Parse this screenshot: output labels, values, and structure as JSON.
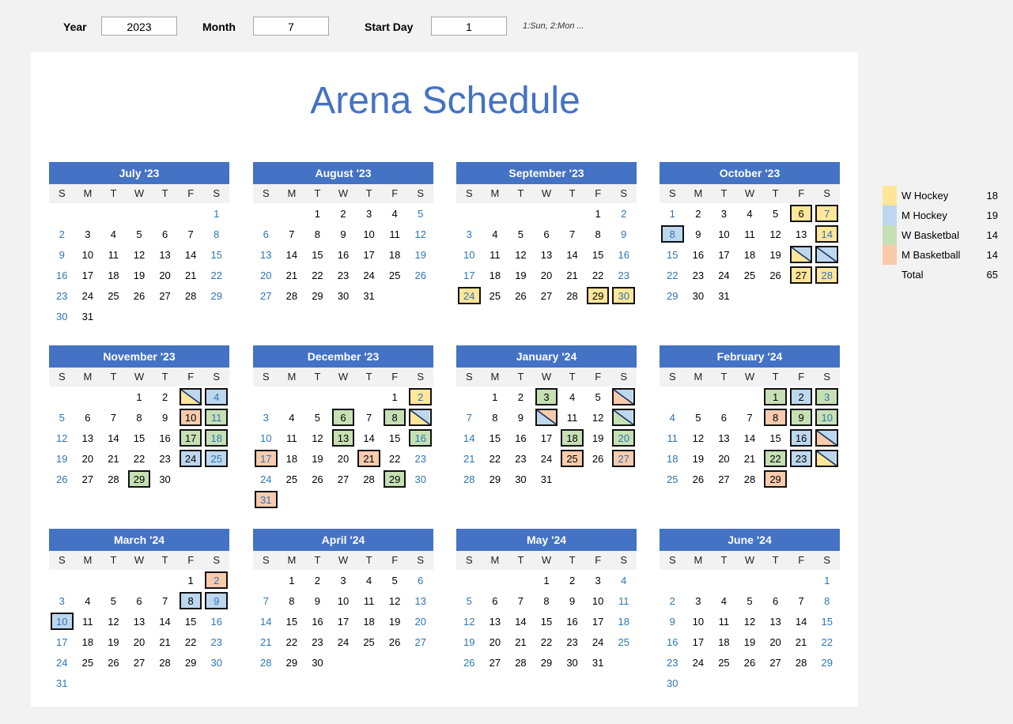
{
  "controls": {
    "year_label": "Year",
    "year_value": "2023",
    "month_label": "Month",
    "month_value": "7",
    "start_label": "Start Day",
    "start_value": "1",
    "hint": "1:Sun, 2:Mon ..."
  },
  "title": "Arena Schedule",
  "dow": [
    "S",
    "M",
    "T",
    "W",
    "T",
    "F",
    "S"
  ],
  "colors": {
    "wh": "#ffe699",
    "mh": "#bdd7ee",
    "wb": "#c6e0b4",
    "mb": "#f8cbad",
    "header": "#4472c4",
    "weekend": "#2e75b6"
  },
  "legend": [
    {
      "name": "W Hockey",
      "value": "18",
      "color": "wh"
    },
    {
      "name": "M Hockey",
      "value": "19",
      "color": "mh"
    },
    {
      "name": "W Basketbal",
      "value": "14",
      "color": "wb"
    },
    {
      "name": "M Basketball",
      "value": "14",
      "color": "mb"
    },
    {
      "name": "Total",
      "value": "65",
      "color": ""
    }
  ],
  "months": [
    {
      "name": "July '23",
      "start": 6,
      "days": 31,
      "events": {}
    },
    {
      "name": "August '23",
      "start": 2,
      "days": 31,
      "events": {}
    },
    {
      "name": "September '23",
      "start": 5,
      "days": 30,
      "events": {
        "24": "wh",
        "29": "wh",
        "30": "wh"
      }
    },
    {
      "name": "October '23",
      "start": 0,
      "days": 31,
      "events": {
        "6": "wh",
        "7": "wh",
        "8": "mh",
        "14": "wh",
        "20": "wh/mh",
        "21": "mh/mh",
        "27": "wh",
        "28": "wh"
      }
    },
    {
      "name": "November '23",
      "start": 3,
      "days": 30,
      "events": {
        "3": "wh/mh",
        "4": "mh",
        "10": "mb",
        "11": "wb",
        "17": "wb",
        "18": "wb",
        "24": "mh",
        "25": "mh",
        "29": "wb"
      }
    },
    {
      "name": "December '23",
      "start": 5,
      "days": 31,
      "events": {
        "2": "wh",
        "6": "wb",
        "8": "wb",
        "9": "wh/mh",
        "13": "wb",
        "16": "wb",
        "17": "mb",
        "21": "mb",
        "29": "wb",
        "31": "mb"
      }
    },
    {
      "name": "January '24",
      "start": 1,
      "days": 31,
      "events": {
        "3": "wb",
        "6": "mb/mh",
        "10": "mh/mb",
        "13": "wb/mh",
        "18": "wb",
        "20": "wb",
        "25": "mb",
        "27": "mb"
      }
    },
    {
      "name": "February '24",
      "start": 4,
      "days": 29,
      "events": {
        "1": "wb",
        "2": "mh",
        "3": "wb",
        "8": "mb",
        "9": "wb",
        "10": "wb",
        "16": "mh",
        "17": "mb/mh",
        "22": "wb",
        "23": "mh",
        "24": "wh/mh",
        "29": "mb"
      }
    },
    {
      "name": "March '24",
      "start": 5,
      "days": 31,
      "events": {
        "2": "mb",
        "8": "mh",
        "9": "mh",
        "10": "mh"
      }
    },
    {
      "name": "April '24",
      "start": 1,
      "days": 30,
      "events": {}
    },
    {
      "name": "May '24",
      "start": 3,
      "days": 31,
      "events": {}
    },
    {
      "name": "June '24",
      "start": 6,
      "days": 30,
      "events": {}
    }
  ]
}
